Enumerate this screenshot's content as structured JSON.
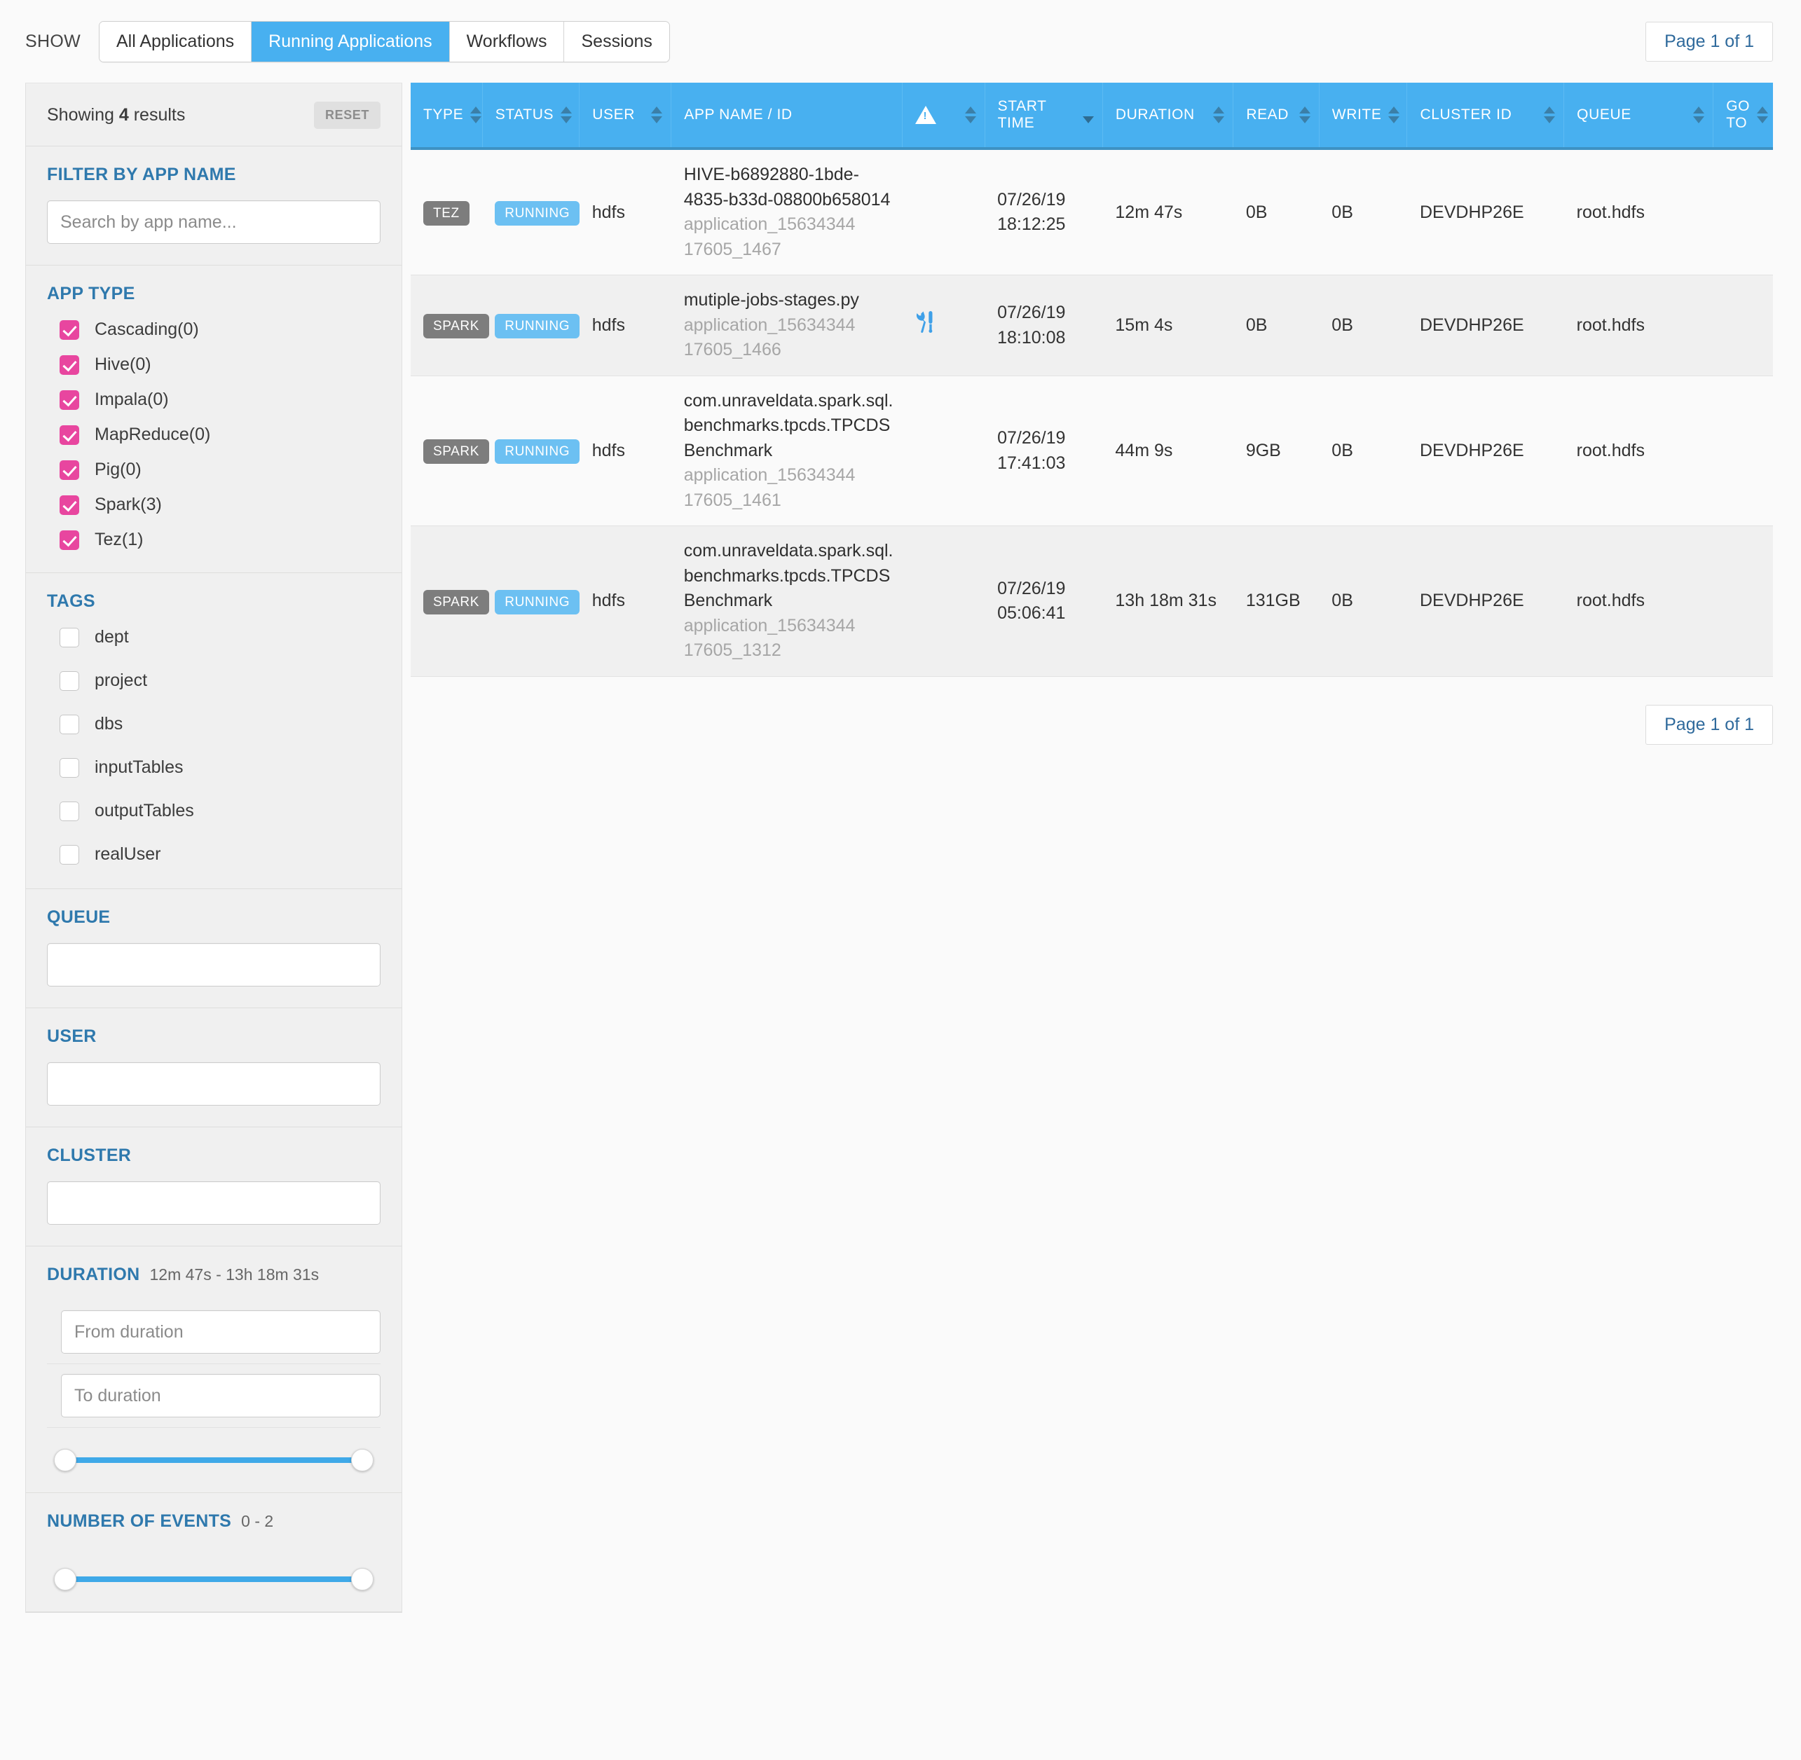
{
  "header": {
    "show_label": "SHOW",
    "tabs": [
      {
        "label": "All Applications",
        "active": false
      },
      {
        "label": "Running Applications",
        "active": true
      },
      {
        "label": "Workflows",
        "active": false
      },
      {
        "label": "Sessions",
        "active": false
      }
    ],
    "pager_label": "Page 1 of 1"
  },
  "sidebar": {
    "showing": "Showing 4 results",
    "showing_count": "4",
    "showing_prefix": "Showing ",
    "showing_suffix": " results",
    "reset_label": "RESET",
    "filter_by_app_name": {
      "title": "FILTER BY APP NAME",
      "placeholder": "Search by app name...",
      "value": ""
    },
    "app_type": {
      "title": "APP TYPE",
      "items": [
        {
          "label": "Cascading(0)",
          "checked": true
        },
        {
          "label": "Hive(0)",
          "checked": true
        },
        {
          "label": "Impala(0)",
          "checked": true
        },
        {
          "label": "MapReduce(0)",
          "checked": true
        },
        {
          "label": "Pig(0)",
          "checked": true
        },
        {
          "label": "Spark(3)",
          "checked": true
        },
        {
          "label": "Tez(1)",
          "checked": true
        }
      ]
    },
    "tags": {
      "title": "TAGS",
      "items": [
        {
          "label": "dept",
          "checked": false
        },
        {
          "label": "project",
          "checked": false
        },
        {
          "label": "dbs",
          "checked": false
        },
        {
          "label": "inputTables",
          "checked": false
        },
        {
          "label": "outputTables",
          "checked": false
        },
        {
          "label": "realUser",
          "checked": false
        }
      ]
    },
    "queue": {
      "title": "QUEUE",
      "value": "",
      "placeholder": ""
    },
    "user": {
      "title": "USER",
      "value": "",
      "placeholder": ""
    },
    "cluster": {
      "title": "CLUSTER",
      "value": "",
      "placeholder": ""
    },
    "duration": {
      "title": "DURATION",
      "range": "12m 47s - 13h 18m 31s",
      "from_placeholder": "From duration",
      "to_placeholder": "To duration",
      "from_value": "",
      "to_value": ""
    },
    "number_of_events": {
      "title": "NUMBER OF EVENTS",
      "range": "0 - 2"
    }
  },
  "table": {
    "columns": [
      {
        "label": "TYPE",
        "sortable": true,
        "icon": ""
      },
      {
        "label": "STATUS",
        "sortable": true,
        "icon": ""
      },
      {
        "label": "USER",
        "sortable": true,
        "icon": ""
      },
      {
        "label": "APP NAME / ID",
        "sortable": false,
        "icon": ""
      },
      {
        "label": "",
        "sortable": true,
        "icon": "warning-icon"
      },
      {
        "label": "START\nTIME",
        "sortable": true,
        "icon": ""
      },
      {
        "label": "DURATION",
        "sortable": true,
        "icon": ""
      },
      {
        "label": "READ",
        "sortable": true,
        "icon": ""
      },
      {
        "label": "WRITE",
        "sortable": true,
        "icon": ""
      },
      {
        "label": "CLUSTER ID",
        "sortable": true,
        "icon": ""
      },
      {
        "label": "QUEUE",
        "sortable": true,
        "icon": ""
      },
      {
        "label": "GO\nTO",
        "sortable": true,
        "icon": ""
      }
    ],
    "sorted_column": "START TIME",
    "sort_direction": "desc",
    "rows": [
      {
        "type": "TEZ",
        "status": "RUNNING",
        "user": "hdfs",
        "app_name": "HIVE-b6892880-1bde-4835-b33d-08800b658014",
        "app_id": "application_156343441 7605_1467",
        "app_id_line1": "application_15634344",
        "app_id_line2": "17605_1467",
        "events_icon": "",
        "start_time_date": "07/26/19",
        "start_time_clock": "18:12:25",
        "duration": "12m 47s",
        "read": "0B",
        "write": "0B",
        "cluster_id": "DEVDHP26E",
        "queue": "root.hdfs",
        "go_to": ""
      },
      {
        "type": "SPARK",
        "status": "RUNNING",
        "user": "hdfs",
        "app_name": "mutiple-jobs-stages.py",
        "app_id_line1": "application_15634344",
        "app_id_line2": "17605_1466",
        "events_icon": "tools-icon",
        "start_time_date": "07/26/19",
        "start_time_clock": "18:10:08",
        "duration": "15m 4s",
        "read": "0B",
        "write": "0B",
        "cluster_id": "DEVDHP26E",
        "queue": "root.hdfs",
        "go_to": ""
      },
      {
        "type": "SPARK",
        "status": "RUNNING",
        "user": "hdfs",
        "app_name": "com.unraveldata.spark.sql.benchmarks.tpcds.TPCDSBenchmark",
        "app_id_line1": "application_15634344",
        "app_id_line2": "17605_1461",
        "events_icon": "",
        "start_time_date": "07/26/19",
        "start_time_clock": "17:41:03",
        "duration": "44m 9s",
        "read": "9GB",
        "write": "0B",
        "cluster_id": "DEVDHP26E",
        "queue": "root.hdfs",
        "go_to": ""
      },
      {
        "type": "SPARK",
        "status": "RUNNING",
        "user": "hdfs",
        "app_name": "com.unraveldata.spark.sql.benchmarks.tpcds.TPCDSBenchmark",
        "app_id_line1": "application_15634344",
        "app_id_line2": "17605_1312",
        "events_icon": "",
        "start_time_date": "07/26/19",
        "start_time_clock": "05:06:41",
        "duration": "13h 18m 31s",
        "read": "131GB",
        "write": "0B",
        "cluster_id": "DEVDHP26E",
        "queue": "root.hdfs",
        "go_to": ""
      }
    ],
    "pager_label": "Page 1 of 1"
  },
  "colors": {
    "accent_blue": "#48b0f0",
    "header_blue": "#48b0f0",
    "checkbox_pink": "#e8469f",
    "type_pill_gray": "#7d7d7d",
    "status_pill_blue": "#6cc0f2",
    "section_title_blue": "#2f79ad",
    "slider_blue": "#3fa9e8"
  }
}
